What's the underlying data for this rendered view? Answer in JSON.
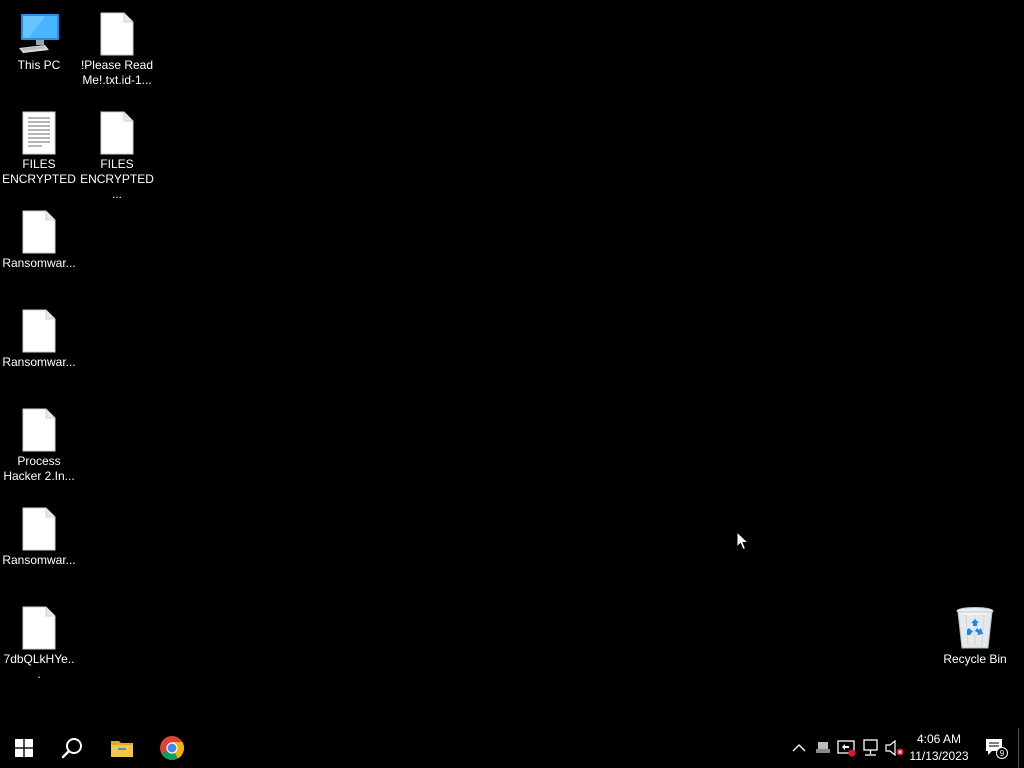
{
  "desktop": {
    "icons": [
      {
        "label": "This PC",
        "icon": "computer-icon"
      },
      {
        "label": "!Please Read Me!.txt.id-1...",
        "icon": "blank-file-icon"
      },
      {
        "label": "FILES ENCRYPTED",
        "icon": "text-document-icon"
      },
      {
        "label": "FILES ENCRYPTED...",
        "icon": "blank-file-icon"
      },
      {
        "label": "Ransomwar...",
        "icon": "blank-file-icon"
      },
      {
        "label": "Ransomwar...",
        "icon": "blank-file-icon"
      },
      {
        "label": "Process Hacker 2.In...",
        "icon": "blank-file-icon"
      },
      {
        "label": "Ransomwar...",
        "icon": "blank-file-icon"
      },
      {
        "label": "7dbQLkHYe...",
        "icon": "blank-file-icon"
      },
      {
        "label": "Recycle Bin",
        "icon": "recycle-bin-icon"
      }
    ]
  },
  "taskbar": {
    "pinned": [
      {
        "name": "start",
        "icon": "windows-logo-icon"
      },
      {
        "name": "search",
        "icon": "search-icon"
      },
      {
        "name": "file-explorer",
        "icon": "folder-icon"
      },
      {
        "name": "chrome",
        "icon": "chrome-icon"
      }
    ],
    "tray": {
      "icons": [
        "chevron-up-icon",
        "network-drive-icon",
        "security-icon",
        "network-icon",
        "speaker-muted-icon"
      ],
      "time": "4:06 AM",
      "date": "11/13/2023",
      "notification_count": "9"
    }
  },
  "colors": {
    "background": "#000000",
    "chrome_red": "#db4437",
    "chrome_green": "#0f9d58",
    "chrome_yellow": "#f4b400",
    "chrome_blue": "#4285f4",
    "folder": "#f2c84b",
    "recycle": "#1e88e5"
  }
}
